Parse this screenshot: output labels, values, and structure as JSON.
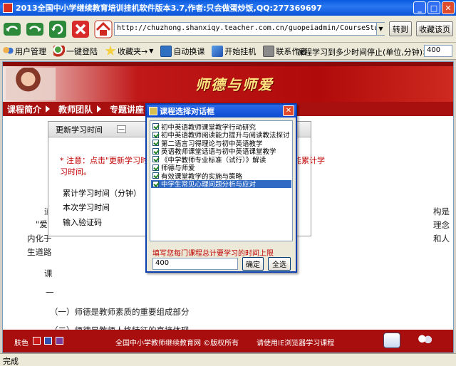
{
  "window": {
    "title": "2013全国中小学继续教育培训挂机软件版本3.7,作者:只会做蛋炒饭,QQ:277369697"
  },
  "nav": {
    "url": "http://chuzhong.shanxiqy.teacher.com.cn/guopeiadmin/CourseStudy/Stu",
    "goto_label": "转到",
    "favorite_label": "收藏该页"
  },
  "toolbar": {
    "items": [
      "用户管理",
      "一键登陆",
      "收藏夹→",
      "自动换课",
      "开始挂机",
      "联系作者"
    ],
    "stop_label": "课程学习到多少时间停止(单位,分钟)>>",
    "stop_value": "400"
  },
  "page": {
    "banner_title": "师德与师爱",
    "tabs": [
      "课程简介",
      "教师团队",
      "专题讲座"
    ],
    "body_fragments": {
      "left_a": "道",
      "left_b": "\"爱岗",
      "left_c": "内化于",
      "left_d": "生道路",
      "right_a": "构是",
      "right_b": "理念",
      "right_c": "和人",
      "item1_prefix": "课",
      "item1_dash": "一",
      "item2": "（一）师德是教师素质的重要组成部分",
      "item3": "（二）师德是教师人格特征的直接体现"
    },
    "footer": {
      "skin_label": "肤色",
      "copyright": "全国中小学教师继续教育网 ©版权所有",
      "ie_notice": "请使用IE浏览器学习课程",
      "skin_colors": [
        "#c81818",
        "#3050b0",
        "#7a3a9a"
      ]
    }
  },
  "update_panel": {
    "title": "更新学习时间",
    "note_a": "* 注意：点击\"更新学习时间",
    "note_b": "在此范围则不能累计学",
    "note_c": "习时间。",
    "fields": [
      "累计学习时间（分钟）",
      "本次学习时间",
      "输入验证码"
    ]
  },
  "dialog": {
    "title": "课程选择对话框",
    "courses": [
      {
        "label": "初中英语教师课堂教学行动研究",
        "checked": true,
        "selected": false
      },
      {
        "label": "初中英语教师阅读能力提升与阅读教法探讨",
        "checked": true,
        "selected": false
      },
      {
        "label": "第二语言习得理论与初中英语教学",
        "checked": true,
        "selected": false
      },
      {
        "label": "英语教师课堂话语与初中英语课堂教学",
        "checked": true,
        "selected": false
      },
      {
        "label": "《中学教师专业标准（试行）》解读",
        "checked": true,
        "selected": false
      },
      {
        "label": "师德与师爱",
        "checked": true,
        "selected": false
      },
      {
        "label": "有效课堂教学的实施与策略",
        "checked": true,
        "selected": false
      },
      {
        "label": "中学生常见心理问题分析与应对",
        "checked": true,
        "selected": true
      }
    ],
    "limit_label": "填写您每门课程总计要学习的时间上限",
    "limit_value": "400",
    "ok_label": "确定",
    "select_all_label": "全选"
  },
  "status": {
    "text": "完成"
  },
  "colors": {
    "titlebar": "#0a5ae0",
    "brand_red": "#a80e0e",
    "note_red": "#c00000",
    "selection": "#316ac5"
  }
}
